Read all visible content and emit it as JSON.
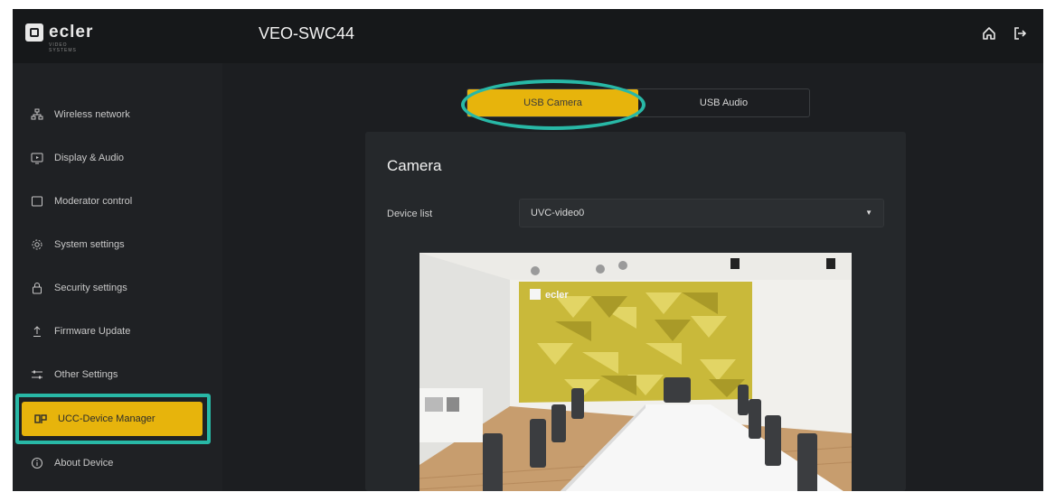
{
  "header": {
    "logo_text": "ecler",
    "logo_subtext": "VIDEO SYSTEMS",
    "device_name": "VEO-SWC44",
    "icons": [
      "home-icon",
      "logout-icon"
    ]
  },
  "sidebar": {
    "items": [
      {
        "label": "Wireless network",
        "icon": "network-icon"
      },
      {
        "label": "Display & Audio",
        "icon": "display-icon"
      },
      {
        "label": "Moderator control",
        "icon": "square-icon"
      },
      {
        "label": "System settings",
        "icon": "gear-icon"
      },
      {
        "label": "Security settings",
        "icon": "lock-icon"
      },
      {
        "label": "Firmware Update",
        "icon": "upload-icon"
      },
      {
        "label": "Other Settings",
        "icon": "sliders-icon"
      },
      {
        "label": "UCC-Device Manager",
        "icon": "device-manager-icon"
      },
      {
        "label": "About Device",
        "icon": "info-icon"
      }
    ],
    "active_index": 7
  },
  "tabs": [
    {
      "label": "USB Camera",
      "active": true
    },
    {
      "label": "USB Audio",
      "active": false
    }
  ],
  "camera": {
    "title": "Camera",
    "device_list_label": "Device list",
    "device_list_value": "UVC-video0"
  },
  "preview": {
    "wall_logo_text": "ecler"
  },
  "colors": {
    "accent": "#e7b40c",
    "highlight": "#28b8a6",
    "background": "#1c1e21"
  }
}
